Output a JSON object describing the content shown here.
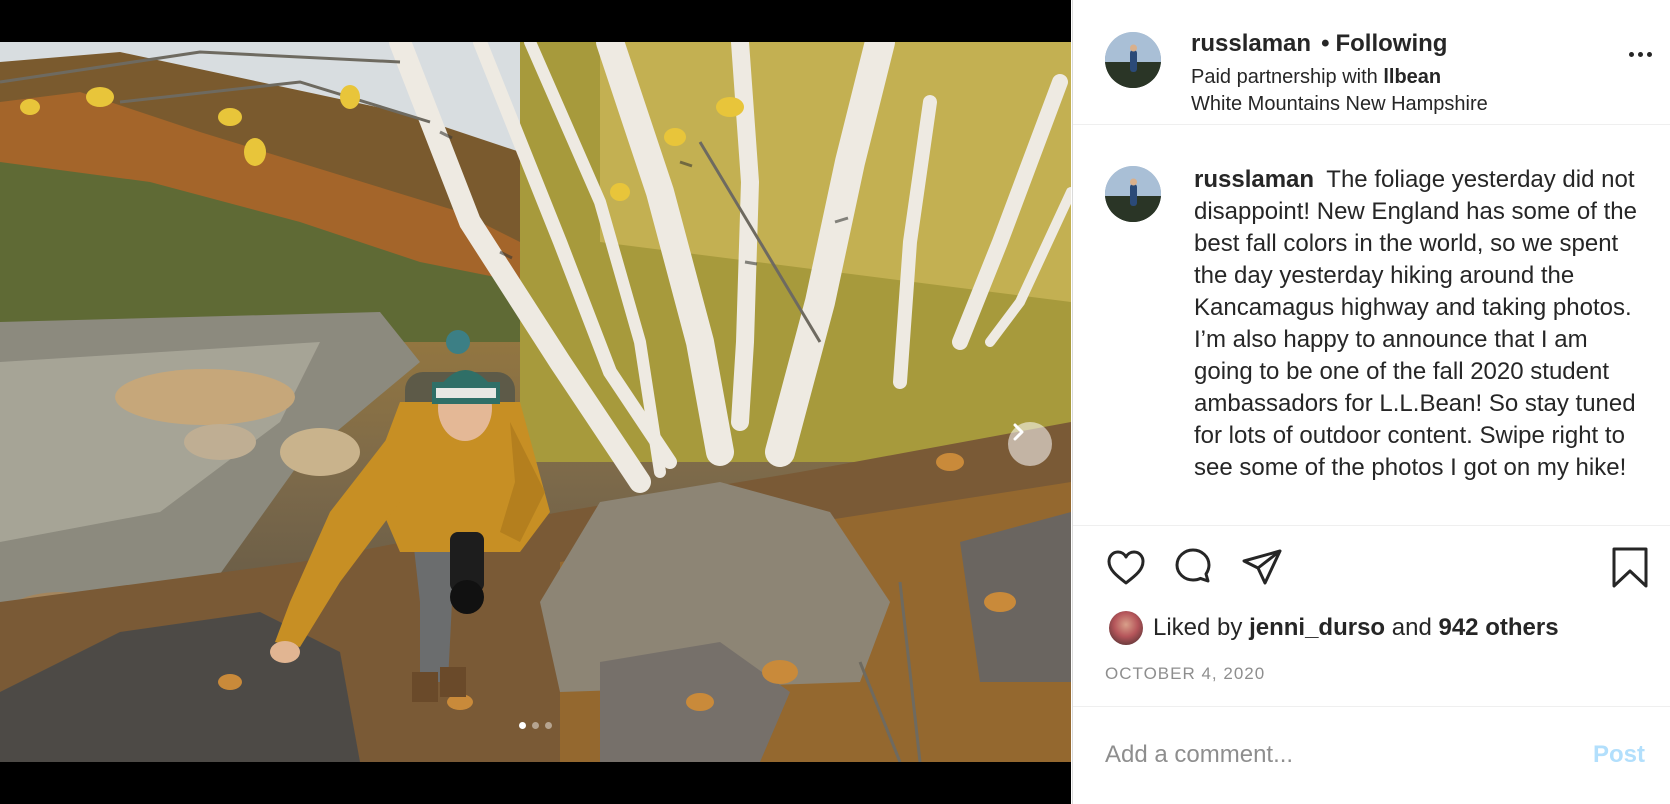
{
  "post": {
    "username": "russlaman",
    "follow_status": "Following",
    "partnership_prefix": "Paid partnership with",
    "partner": "llbean",
    "location": "White Mountains New Hampshire"
  },
  "caption": {
    "username": "russlaman",
    "text": "The foliage yesterday did not disappoint! New England has some of the best fall colors in the world, so we spent the day yesterday hiking around the Kancamagus highway and taking photos. I’m also happy to announce that I am going to be one of the fall 2020 student ambassadors for L.L.Bean! So stay tuned for lots of outdoor content. Swipe right to see some of the photos I got on my hike!"
  },
  "likes": {
    "prefix": "Liked by",
    "user": "jenni_durso",
    "joiner": "and",
    "others": "942 others"
  },
  "date": "OCTOBER 4, 2020",
  "comment": {
    "placeholder": "Add a comment...",
    "post_label": "Post"
  },
  "carousel": {
    "current": 1,
    "total": 3
  },
  "icons": {
    "like": "heart-icon",
    "comment": "comment-icon",
    "share": "share-icon",
    "save": "bookmark-icon",
    "more": "more-icon",
    "next": "chevron-right-icon"
  },
  "colors": {
    "text": "#262626",
    "muted": "#8e8e8e",
    "post_disabled": "#b2dffc",
    "divider": "#efefef"
  }
}
